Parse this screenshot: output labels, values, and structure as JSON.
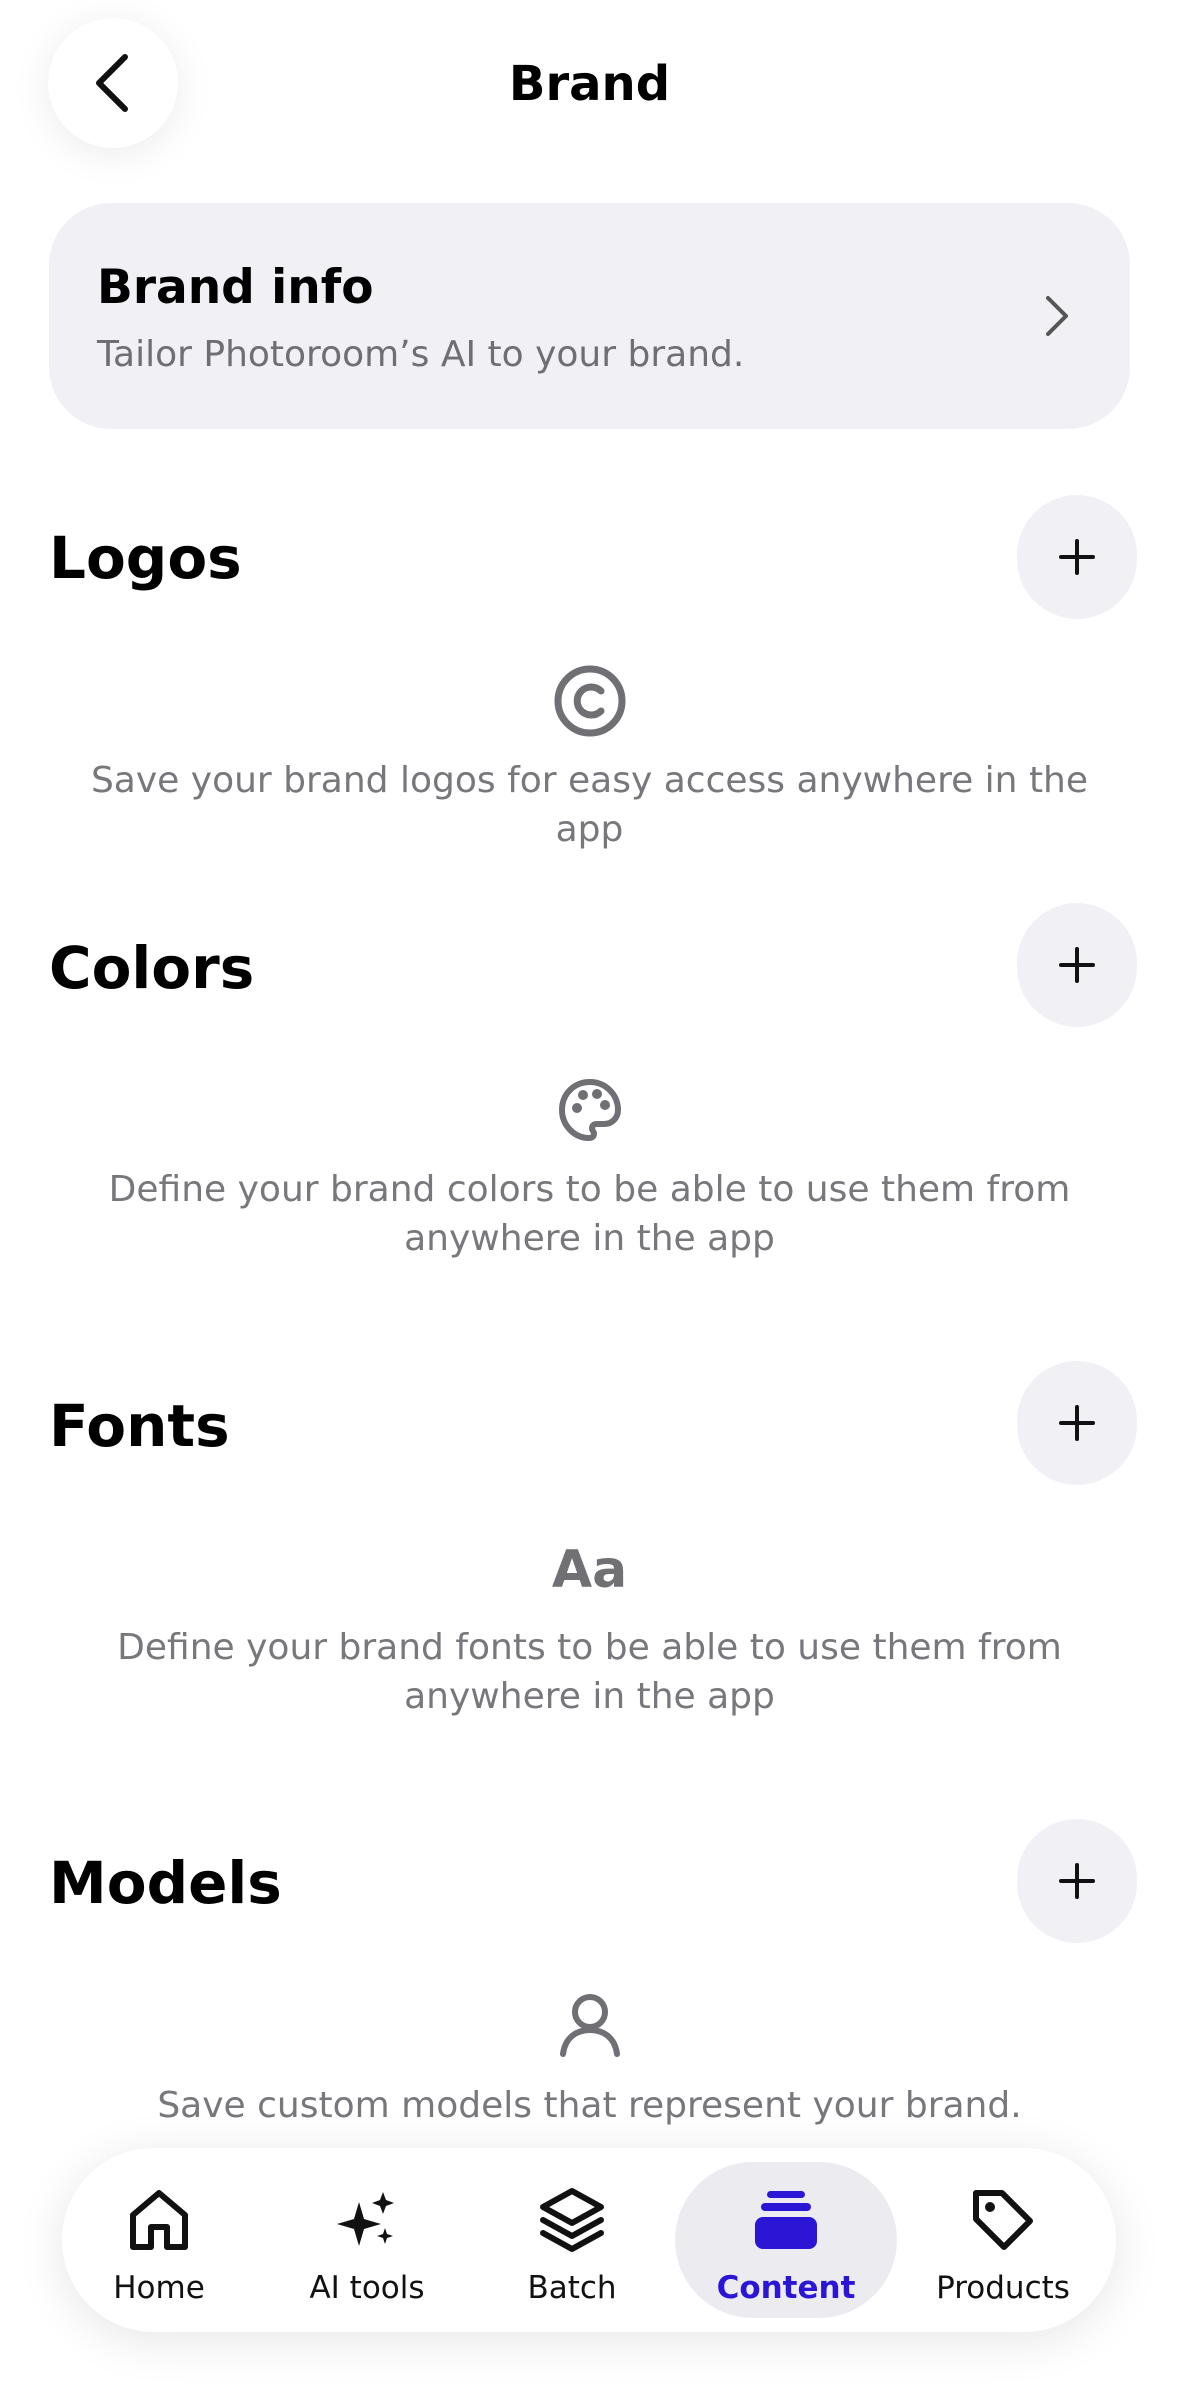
{
  "header": {
    "title": "Brand",
    "back_icon": "chevron-left-icon"
  },
  "brand_info": {
    "title": "Brand info",
    "subtitle": "Tailor Photoroom’s AI to your brand.",
    "chevron_icon": "chevron-right-icon"
  },
  "sections": {
    "logos": {
      "title": "Logos",
      "icon": "copyright-icon",
      "empty_text": "Save your brand logos for easy access anywhere in the app",
      "add_icon": "plus-icon"
    },
    "colors": {
      "title": "Colors",
      "icon": "palette-icon",
      "empty_text_line1": "Define your brand colors to be able to use them from",
      "empty_text_line2": "anywhere in the app",
      "add_icon": "plus-icon"
    },
    "fonts": {
      "title": "Fonts",
      "icon_text": "Aa",
      "empty_text_line1": "Define your brand fonts to be able to use them from",
      "empty_text_line2": "anywhere in the app",
      "add_icon": "plus-icon"
    },
    "models": {
      "title": "Models",
      "icon": "person-icon",
      "empty_text": "Save custom models that represent your brand.",
      "add_icon": "plus-icon"
    }
  },
  "bottom_nav": {
    "items": [
      {
        "label": "Home",
        "icon": "home-icon",
        "active": false
      },
      {
        "label": "AI tools",
        "icon": "sparkles-icon",
        "active": false
      },
      {
        "label": "Batch",
        "icon": "layers-icon",
        "active": false
      },
      {
        "label": "Content",
        "icon": "content-stack-icon",
        "active": true
      },
      {
        "label": "Products",
        "icon": "tag-icon",
        "active": false
      }
    ]
  },
  "colors": {
    "accent": "#2b16d6",
    "card_background": "#f1f1f5",
    "muted_text": "#77777c"
  }
}
